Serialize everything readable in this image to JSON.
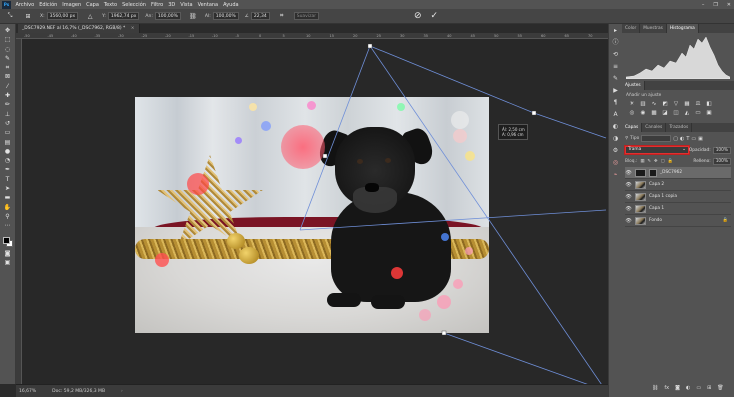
{
  "menu": {
    "logo": "Ps",
    "items": [
      "Archivo",
      "Edición",
      "Imagen",
      "Capa",
      "Texto",
      "Selección",
      "Filtro",
      "3D",
      "Vista",
      "Ventana",
      "Ayuda"
    ],
    "window_controls": [
      "–",
      "❐",
      "✕"
    ]
  },
  "options": {
    "x_label": "X:",
    "x_value": "3560,00 px",
    "y_label": "Y:",
    "y_value": "1962,74 px",
    "w_label": "An:",
    "w_value": "100,00%",
    "h_label": "Al:",
    "h_value": "100,00%",
    "angle_value": "22,34",
    "interp": "Suavizar",
    "cancel_icon": "⊘",
    "commit_icon": "✓"
  },
  "document": {
    "tab_title": "_DSC7929.NEF al 16,7% (_DSC7962, RGB/8) *",
    "close": "×"
  },
  "ruler_ticks": [
    "-50",
    "-45",
    "-40",
    "-35",
    "-30",
    "-25",
    "-20",
    "-15",
    "-10",
    "-5",
    "0",
    "5",
    "10",
    "15",
    "20",
    "25",
    "30",
    "35",
    "40",
    "45",
    "50",
    "55",
    "60",
    "65",
    "70"
  ],
  "transform_info": {
    "line1": "Ál: 2,50 cm",
    "line2": "A: 0,96 cm"
  },
  "status": {
    "zoom": "16,67%",
    "doc": "Doc: 59,2 MB/326,3 MB",
    "arrow": "›"
  },
  "panels": {
    "top_tabs": [
      "Color",
      "Muestras",
      "Histograma"
    ],
    "adjust_tab": "Ajustes",
    "adjust_title": "Añadir un ajuste",
    "layer_tabs": [
      "Capas",
      "Canales",
      "Trazados"
    ],
    "filter_label": "Tipo",
    "blend_mode": "Trama",
    "opacity_label": "Opacidad:",
    "opacity_value": "100%",
    "lock_label": "Bloq.:",
    "fill_label": "Relleno:",
    "fill_value": "100%",
    "layers": [
      {
        "name": "_DSC7962",
        "selected": true
      },
      {
        "name": "Capa 2",
        "selected": false
      },
      {
        "name": "Capa 1 copia",
        "selected": false
      },
      {
        "name": "Capa 1",
        "selected": false
      },
      {
        "name": "Fondo",
        "selected": false
      }
    ]
  },
  "colors": {
    "accent_red": "#e03030",
    "panel_bg": "#535353",
    "workspace_bg": "#282828"
  }
}
